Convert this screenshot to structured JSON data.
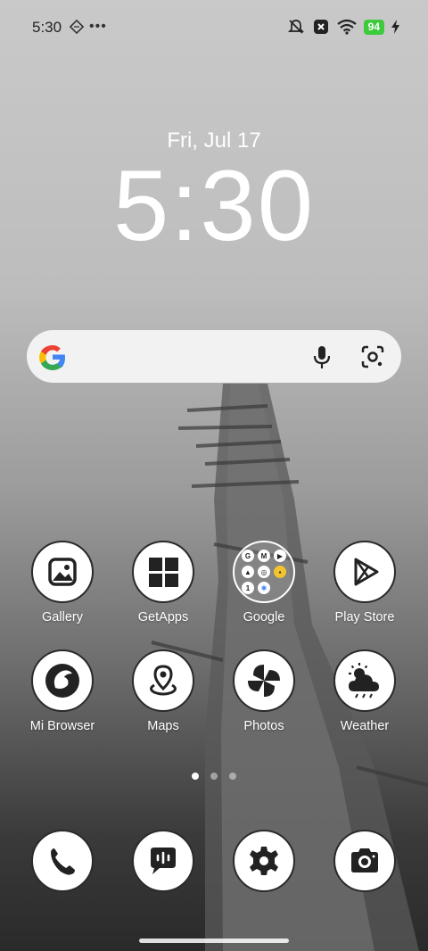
{
  "status_bar": {
    "time": "5:30",
    "battery": "94"
  },
  "lockscreen": {
    "date": "Fri, Jul 17",
    "clock": "5:30"
  },
  "apps": [
    {
      "label": "Gallery",
      "icon": "gallery-icon"
    },
    {
      "label": "GetApps",
      "icon": "getapps-icon"
    },
    {
      "label": "Google",
      "icon": "google-folder-icon"
    },
    {
      "label": "Play Store",
      "icon": "play-store-icon"
    },
    {
      "label": "Mi Browser",
      "icon": "mi-browser-icon"
    },
    {
      "label": "Maps",
      "icon": "maps-icon"
    },
    {
      "label": "Photos",
      "icon": "photos-icon"
    },
    {
      "label": "Weather",
      "icon": "weather-icon"
    }
  ],
  "dock": [
    {
      "icon": "phone-icon"
    },
    {
      "icon": "messages-icon"
    },
    {
      "icon": "settings-icon"
    },
    {
      "icon": "camera-icon"
    }
  ],
  "page_indicator": {
    "pages": 3,
    "active": 1
  }
}
